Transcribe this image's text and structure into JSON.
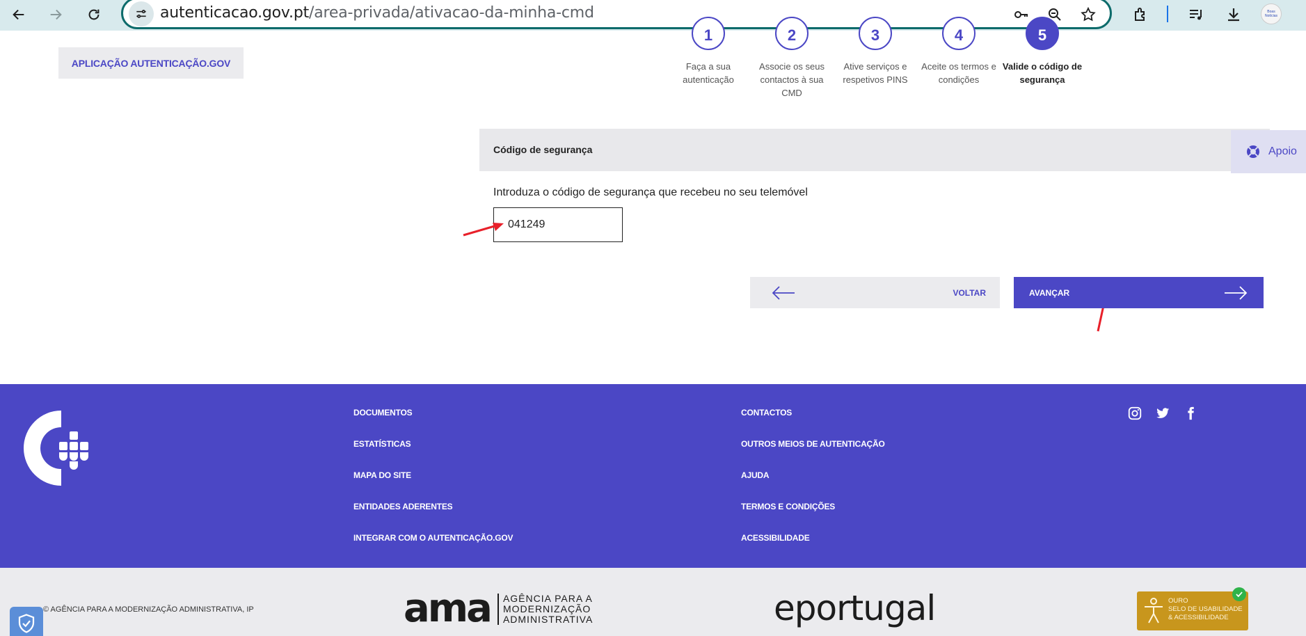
{
  "browser": {
    "url_host": "autenticacao.gov.pt",
    "url_path": "/area-privada/ativacao-da-minha-cmd",
    "profile_label": "Boas Notícias"
  },
  "header": {
    "app_button": "APLICAÇÃO AUTENTICAÇÃO.GOV"
  },
  "steps": [
    {
      "number": "1",
      "label": "Faça a sua autenticação"
    },
    {
      "number": "2",
      "label": "Associe os seus contactos à sua CMD"
    },
    {
      "number": "3",
      "label": "Ative serviços e respetivos PINS"
    },
    {
      "number": "4",
      "label": "Aceite os termos e condições"
    },
    {
      "number": "5",
      "label": "Valide o código de segurança",
      "active": true
    }
  ],
  "security": {
    "title": "Código de segurança",
    "instruction": "Introduza o código de segurança que recebeu no seu telemóvel",
    "code_value": "041249"
  },
  "support": {
    "label": "Apoio"
  },
  "buttons": {
    "back": "VOLTAR",
    "next": "AVANÇAR"
  },
  "footer": {
    "col1": [
      "DOCUMENTOS",
      "ESTATÍSTICAS",
      "MAPA DO SITE",
      "ENTIDADES ADERENTES",
      "INTEGRAR COM O AUTENTICAÇÃO.GOV"
    ],
    "col2": [
      "CONTACTOS",
      "OUTROS MEIOS DE AUTENTICAÇÃO",
      "AJUDA",
      "TERMOS E CONDIÇÕES",
      "ACESSIBILIDADE"
    ],
    "social": [
      "instagram-icon",
      "twitter-icon",
      "facebook-icon"
    ]
  },
  "bottom": {
    "copyright": "© AGÊNCIA PARA A MODERNIZAÇÃO ADMINISTRATIVA, IP",
    "ama_mark": "ama",
    "ama_text_1": "AGÊNCIA PARA A",
    "ama_text_2": "MODERNIZAÇÃO",
    "ama_text_3": "ADMINISTRATIVA",
    "eportugal": "eportugal",
    "selo_1": "OURO",
    "selo_2": "SELO DE USABILIDADE",
    "selo_3": "& ACESSIBILIDADE"
  },
  "colors": {
    "brand": "#4b47c5",
    "annotation": "#e8202a"
  }
}
